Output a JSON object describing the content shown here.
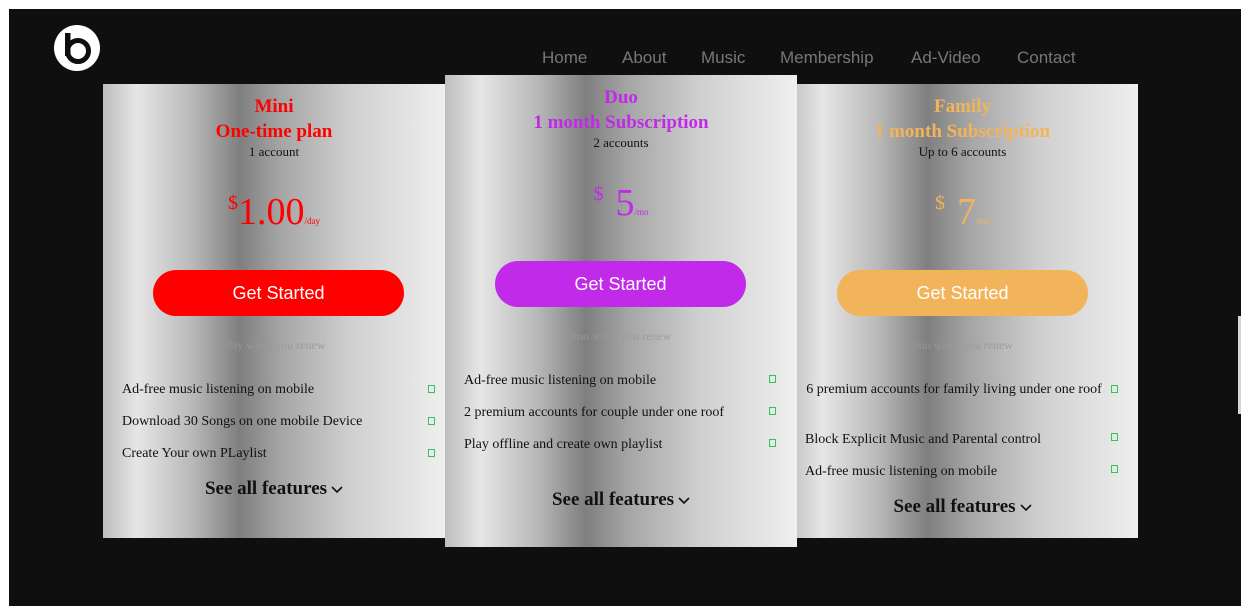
{
  "nav": {
    "items": [
      "Home",
      "About",
      "Music",
      "Membership",
      "Ad-Video",
      "Contact"
    ]
  },
  "colors": {
    "mini": "#ff0000",
    "duo": "#c12ae9",
    "family": "#f2b45a",
    "background": "#0f0f10"
  },
  "plans": [
    {
      "name": "Mini",
      "type": "One-time plan",
      "accounts": "1 account",
      "currency": "$",
      "price": "1.00",
      "period": "/day",
      "cta": "Get Started",
      "renew": "/day when you renew",
      "features": [
        "Ad-free music listening on mobile",
        "Download 30 Songs on one mobile Device",
        "Create Your own PLaylist"
      ],
      "see_all": "See all features"
    },
    {
      "name": "Duo",
      "type": "1 month Subscription",
      "accounts": "2 accounts",
      "currency": "$",
      "price": "5",
      "period": "/mo",
      "cta": "Get Started",
      "renew": "/mo when you renew",
      "features": [
        "Ad-free music listening on mobile",
        "2 premium accounts for couple under one roof",
        "Play offline and create own playlist"
      ],
      "see_all": "See all features"
    },
    {
      "name": "Family",
      "type": "1 month Subscription",
      "accounts": "Up to 6 accounts",
      "currency": "$",
      "price": "7",
      "period": "/mo",
      "cta": "Get Started",
      "renew": "/mo when you renew",
      "features": [
        "6 premium accounts for family living under one roof",
        "Block Explicit Music and Parental control",
        "Ad-free music listening on mobile"
      ],
      "see_all": "See all features"
    }
  ]
}
